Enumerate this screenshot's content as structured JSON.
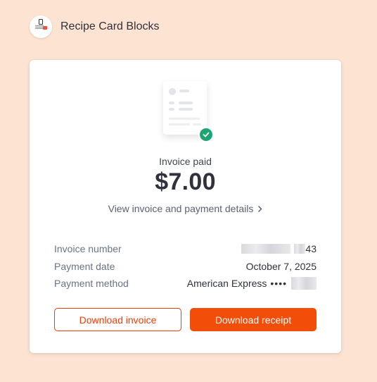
{
  "merchant": {
    "name": "Recipe Card Blocks",
    "logo_icon": "recipe-card-logo-icon"
  },
  "receipt": {
    "status_label": "Invoice paid",
    "amount": "$7.00",
    "view_details_label": "View invoice and payment details"
  },
  "details": {
    "invoice_number_label": "Invoice number",
    "invoice_number_suffix": "43",
    "payment_date_label": "Payment date",
    "payment_date": "October 7, 2025",
    "payment_method_label": "Payment method",
    "payment_method_brand": "American Express",
    "masked_dots": "••••"
  },
  "actions": {
    "download_invoice": "Download invoice",
    "download_receipt": "Download receipt"
  },
  "colors": {
    "background": "#fde3d2",
    "accent": "#f24e0a",
    "success": "#1ea672"
  }
}
